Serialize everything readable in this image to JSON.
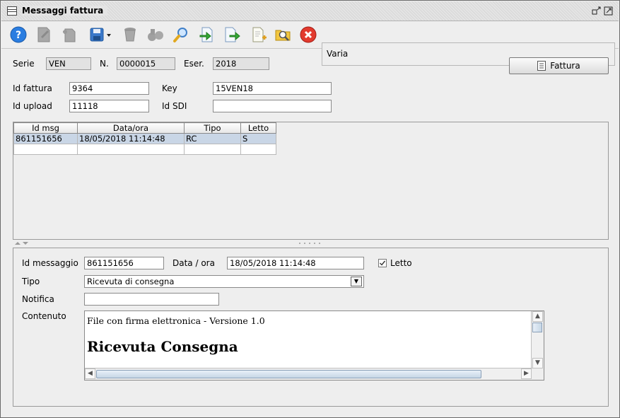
{
  "window": {
    "title": "Messaggi fattura"
  },
  "toolbar": {
    "buttons": [
      {
        "name": "help",
        "icon": "help-icon"
      },
      {
        "name": "edit",
        "icon": "edit-icon"
      },
      {
        "name": "new",
        "icon": "new-document-icon"
      },
      {
        "name": "save",
        "icon": "save-icon"
      },
      {
        "name": "delete",
        "icon": "trash-icon"
      },
      {
        "name": "binoculars",
        "icon": "binoculars-icon"
      },
      {
        "name": "search",
        "icon": "magnifier-icon"
      },
      {
        "name": "import",
        "icon": "import-arrow-icon"
      },
      {
        "name": "export",
        "icon": "export-arrow-icon"
      },
      {
        "name": "add",
        "icon": "add-document-icon"
      },
      {
        "name": "find",
        "icon": "folder-search-icon"
      },
      {
        "name": "close",
        "icon": "close-icon"
      }
    ],
    "varia": "Varia"
  },
  "header": {
    "serie_label": "Serie",
    "serie": "VEN",
    "n_label": "N.",
    "n": "0000015",
    "eser_label": "Eser.",
    "eser": "2018",
    "fattura_button": "Fattura"
  },
  "ids": {
    "id_fattura_label": "Id fattura",
    "id_fattura": "9364",
    "key_label": "Key",
    "key": "15VEN18",
    "id_upload_label": "Id upload",
    "id_upload": "11118",
    "id_sdi_label": "Id SDI",
    "id_sdi": ""
  },
  "grid": {
    "columns": [
      "Id msg",
      "Data/ora",
      "Tipo",
      "Letto"
    ],
    "rows": [
      [
        "861151656",
        "18/05/2018 11:14:48",
        "RC",
        "S"
      ]
    ]
  },
  "detail": {
    "id_messaggio_label": "Id messaggio",
    "id_messaggio": "861151656",
    "data_ora_label": "Data / ora",
    "data_ora": "18/05/2018 11:14:48",
    "letto_label": "Letto",
    "letto_checked": true,
    "tipo_label": "Tipo",
    "tipo": "Ricevuta di consegna",
    "notifica_label": "Notifica",
    "notifica": "",
    "contenuto_label": "Contenuto",
    "contenuto_line1": "File con firma elettronica - Versione 1.0",
    "contenuto_line2": "Ricevuta Consegna"
  }
}
